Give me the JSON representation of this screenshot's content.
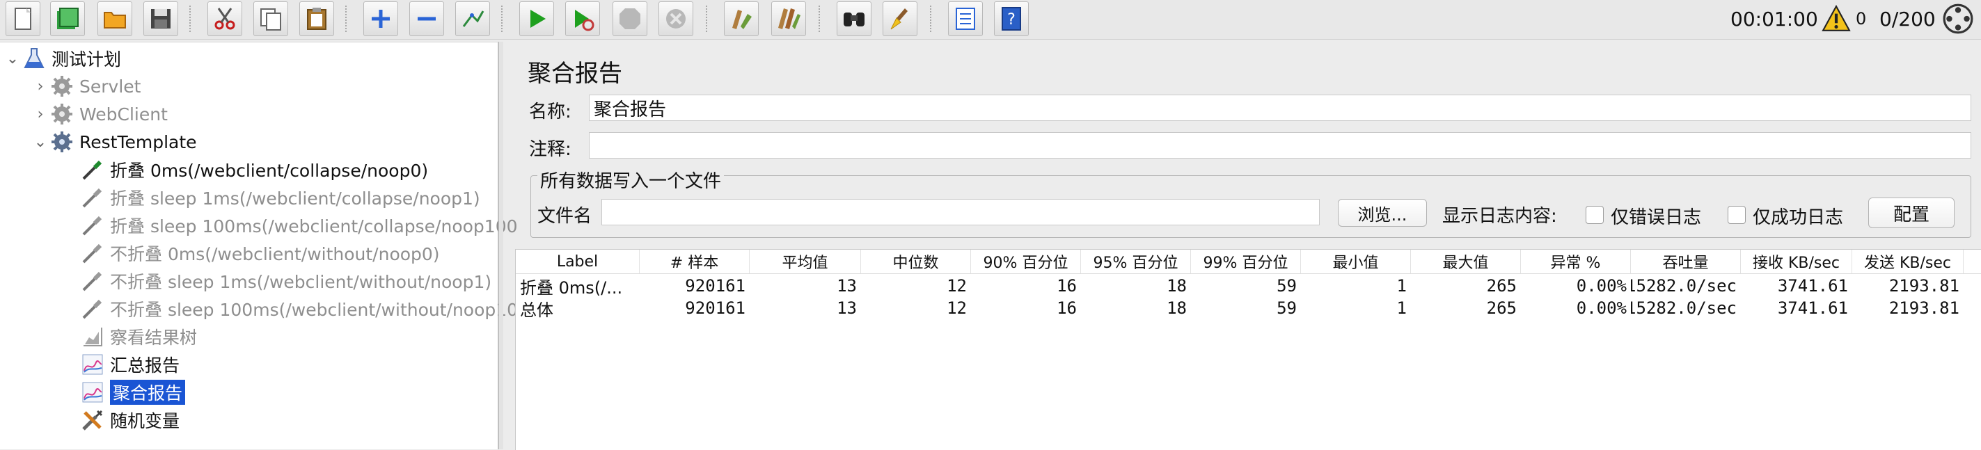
{
  "toolbar": {
    "buttons": [
      {
        "name": "new-icon"
      },
      {
        "name": "templates-icon"
      },
      {
        "name": "open-icon"
      },
      {
        "name": "save-icon"
      },
      {
        "name": "cut-icon"
      },
      {
        "name": "copy-icon"
      },
      {
        "name": "paste-icon"
      },
      {
        "name": "expand-icon"
      },
      {
        "name": "collapse-icon"
      },
      {
        "name": "toggle-icon"
      },
      {
        "name": "start-icon"
      },
      {
        "name": "start-no-pauses-icon"
      },
      {
        "name": "stop-icon"
      },
      {
        "name": "shutdown-icon"
      },
      {
        "name": "clear-icon"
      },
      {
        "name": "clear-all-icon"
      },
      {
        "name": "search-icon"
      },
      {
        "name": "reset-search-icon"
      },
      {
        "name": "function-helper-icon"
      },
      {
        "name": "help-icon"
      }
    ],
    "elapsed_time": "00:01:00",
    "warning_count": "0",
    "threads": "0/200"
  },
  "tree": {
    "root": "测试计划",
    "groups": [
      "Servlet",
      "WebClient",
      "RestTemplate"
    ],
    "items": [
      "折叠 0ms(/webclient/collapse/noop0)",
      "折叠 sleep 1ms(/webclient/collapse/noop1)",
      "折叠 sleep 100ms(/webclient/collapse/noop100",
      "不折叠 0ms(/webclient/without/noop0)",
      "不折叠 sleep 1ms(/webclient/without/noop1)",
      "不折叠 sleep 100ms(/webclient/without/noop10",
      "察看结果树",
      "汇总报告",
      "聚合报告",
      "随机变量"
    ]
  },
  "panel": {
    "title": "聚合报告",
    "name_label": "名称:",
    "name_value": "聚合报告",
    "comment_label": "注释:",
    "comment_value": "",
    "file_group_title": "所有数据写入一个文件",
    "filename_label": "文件名",
    "filename_value": "",
    "browse_button": "浏览...",
    "log_content_label": "显示日志内容:",
    "errors_only_label": "仅错误日志",
    "success_only_label": "仅成功日志",
    "configure_button": "配置"
  },
  "table": {
    "headers": [
      "Label",
      "# 样本",
      "平均值",
      "中位数",
      "90% 百分位",
      "95% 百分位",
      "99% 百分位",
      "最小值",
      "最大值",
      "异常 %",
      "吞吐量",
      "接收 KB/sec",
      "发送 KB/sec"
    ],
    "rows": [
      [
        "折叠 0ms(/...",
        "920161",
        "13",
        "12",
        "16",
        "18",
        "59",
        "1",
        "265",
        "0.00%",
        "15282.0/sec",
        "3741.61",
        "2193.81"
      ],
      [
        "总体",
        "920161",
        "13",
        "12",
        "16",
        "18",
        "59",
        "1",
        "265",
        "0.00%",
        "15282.0/sec",
        "3741.61",
        "2193.81"
      ]
    ]
  },
  "colors": {
    "selection": "#1a55d4",
    "start_green": "#1ea01e",
    "warning_yellow": "#f3c21a"
  }
}
